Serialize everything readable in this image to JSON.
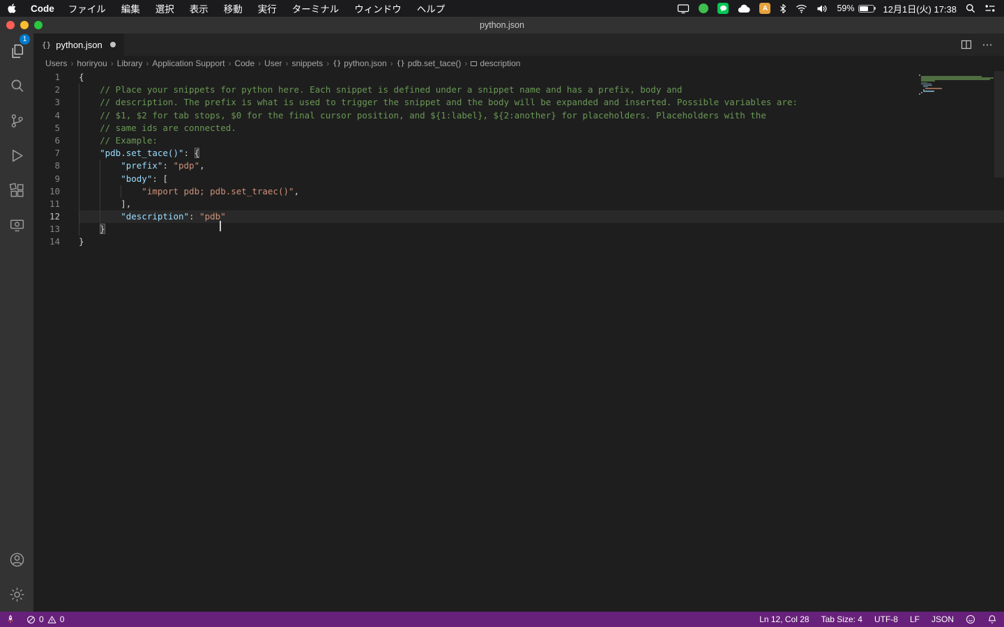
{
  "palette": {
    "statusbar_background": "#68217A",
    "badge_background": "#007ACC",
    "syntax_comment": "#6A9955",
    "syntax_key": "#9CDCFE",
    "syntax_string": "#CE9178",
    "syntax_punctuation": "#D4D4D4",
    "editor_background": "#1e1e1e"
  },
  "icon_glyphs": {
    "braces": "{}"
  },
  "menubar": {
    "app_name": "Code",
    "menus": [
      "ファイル",
      "編集",
      "選択",
      "表示",
      "移動",
      "実行",
      "ターミナル",
      "ウィンドウ",
      "ヘルプ"
    ],
    "input_method_label": "A",
    "battery_percent": "59%",
    "clock": "12月1日(火) 17:38"
  },
  "window": {
    "title": "python.json"
  },
  "activity_bar": {
    "explorer_badge": "1"
  },
  "tab": {
    "icon_label": "{}",
    "label": "python.json",
    "modified": true
  },
  "breadcrumbs": [
    {
      "label": "Users"
    },
    {
      "label": "horiryou"
    },
    {
      "label": "Library"
    },
    {
      "label": "Application Support"
    },
    {
      "label": "Code"
    },
    {
      "label": "User"
    },
    {
      "label": "snippets"
    },
    {
      "label": "python.json",
      "icon": "braces"
    },
    {
      "label": "pdb.set_tace()",
      "icon": "braces"
    },
    {
      "label": "description",
      "icon": "symbol"
    }
  ],
  "editor": {
    "lines": [
      {
        "num": "1",
        "guides": 0,
        "segments": [
          {
            "c": "punct",
            "t": "{"
          }
        ]
      },
      {
        "num": "2",
        "guides": 1,
        "segments": [
          {
            "c": "comment",
            "t": "    // Place your snippets for python here. Each snippet is defined under a snippet name and has a prefix, body and"
          }
        ]
      },
      {
        "num": "3",
        "guides": 1,
        "segments": [
          {
            "c": "comment",
            "t": "    // description. The prefix is what is used to trigger the snippet and the body will be expanded and inserted. Possible variables are:"
          }
        ]
      },
      {
        "num": "4",
        "guides": 1,
        "segments": [
          {
            "c": "comment",
            "t": "    // $1, $2 for tab stops, $0 for the final cursor position, and ${1:label}, ${2:another} for placeholders. Placeholders with the"
          }
        ]
      },
      {
        "num": "5",
        "guides": 1,
        "segments": [
          {
            "c": "comment",
            "t": "    // same ids are connected."
          }
        ]
      },
      {
        "num": "6",
        "guides": 1,
        "segments": [
          {
            "c": "comment",
            "t": "    // Example:"
          }
        ]
      },
      {
        "num": "7",
        "guides": 1,
        "segments": [
          {
            "c": "key",
            "t": "    \"pdb.set_tace()\""
          },
          {
            "c": "punct",
            "t": ": "
          },
          {
            "c": "punct",
            "t": "{",
            "bracket": true
          }
        ]
      },
      {
        "num": "8",
        "guides": 2,
        "segments": [
          {
            "c": "key",
            "t": "        \"prefix\""
          },
          {
            "c": "punct",
            "t": ": "
          },
          {
            "c": "string",
            "t": "\"pdp\""
          },
          {
            "c": "punct",
            "t": ","
          }
        ]
      },
      {
        "num": "9",
        "guides": 2,
        "segments": [
          {
            "c": "key",
            "t": "        \"body\""
          },
          {
            "c": "punct",
            "t": ": ["
          }
        ]
      },
      {
        "num": "10",
        "guides": 3,
        "segments": [
          {
            "c": "string",
            "t": "            \"import pdb; pdb.set_traec()\""
          },
          {
            "c": "punct",
            "t": ","
          }
        ]
      },
      {
        "num": "11",
        "guides": 2,
        "segments": [
          {
            "c": "punct",
            "t": "        ],"
          }
        ]
      },
      {
        "num": "12",
        "guides": 2,
        "current": true,
        "segments": [
          {
            "c": "key",
            "t": "        \"description\""
          },
          {
            "c": "punct",
            "t": ": "
          },
          {
            "c": "string",
            "t": "\"pdb"
          },
          {
            "cursor": true
          },
          {
            "c": "string",
            "t": "\""
          }
        ]
      },
      {
        "num": "13",
        "guides": 1,
        "segments": [
          {
            "c": "punct",
            "t": "    "
          },
          {
            "c": "punct",
            "t": "}",
            "bracket": true
          }
        ]
      },
      {
        "num": "14",
        "guides": 0,
        "segments": [
          {
            "c": "punct",
            "t": "}"
          }
        ]
      }
    ]
  },
  "statusbar": {
    "errors": "0",
    "warnings": "0",
    "cursor_position": "Ln 12, Col 28",
    "tab_size": "Tab Size: 4",
    "encoding": "UTF-8",
    "eol": "LF",
    "language": "JSON"
  }
}
